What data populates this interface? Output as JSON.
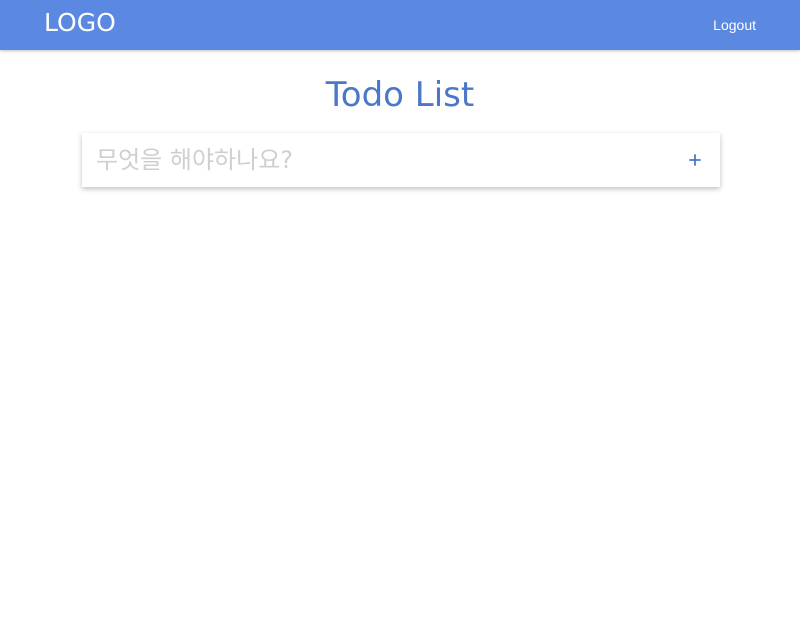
{
  "header": {
    "logo": "LOGO",
    "logout_label": "Logout"
  },
  "main": {
    "title": "Todo List",
    "todo_input": {
      "placeholder": "무엇을 해야하나요?",
      "value": ""
    },
    "add_icon": "plus-icon"
  },
  "colors": {
    "header_bg": "#5b88e0",
    "title": "#4b77c9",
    "placeholder": "#cfcfcf",
    "add_icon": "#4b77c9"
  }
}
